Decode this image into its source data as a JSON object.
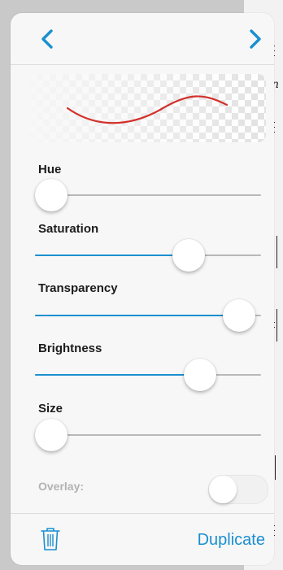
{
  "colors": {
    "accent": "#1a8fd0",
    "stroke_preview": "#d3312b",
    "track": "#b8b8b8",
    "disabled_text": "#b3b3b3"
  },
  "navigation": {
    "prev_icon": "chevron-left-icon",
    "next_icon": "chevron-right-icon"
  },
  "preview": {
    "stroke_color": "#d3312b"
  },
  "sliders": [
    {
      "label": "Hue",
      "value": 0.0
    },
    {
      "label": "Saturation",
      "value": 0.71
    },
    {
      "label": "Transparency",
      "value": 0.97
    },
    {
      "label": "Brightness",
      "value": 0.77
    },
    {
      "label": "Size",
      "value": 0.0
    }
  ],
  "overlay": {
    "label": "Overlay:",
    "enabled": false
  },
  "footer": {
    "delete_icon": "trash-icon",
    "duplicate_label": "Duplicate"
  }
}
